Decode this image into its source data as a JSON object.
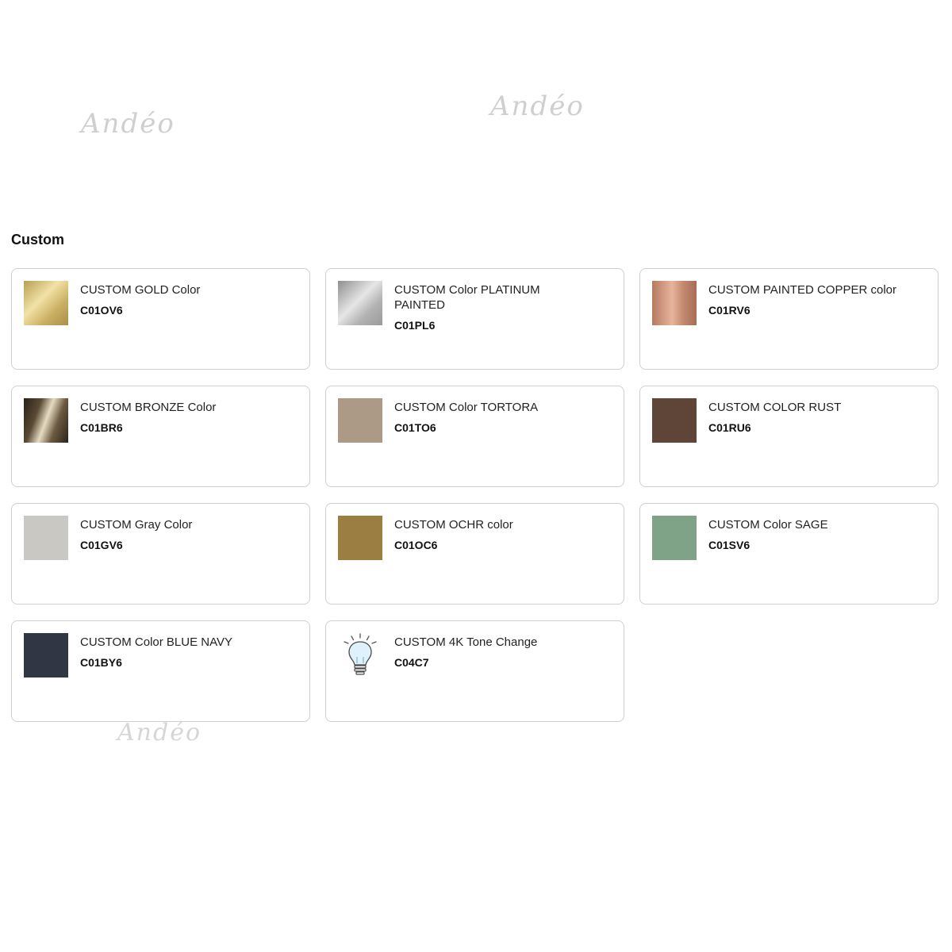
{
  "watermark": "Andéo",
  "section": {
    "title": "Custom"
  },
  "items": [
    {
      "name": "CUSTOM GOLD Color",
      "code": "C01OV6",
      "swatch": "linear-gradient(135deg,#b79f55 0%,#f1e2a6 40%,#c9ae62 70%,#a98f49 100%)"
    },
    {
      "name": "CUSTOM Color PLATINUM PAINTED",
      "code": "C01PL6",
      "swatch": "linear-gradient(135deg,#8f8f8f 0%,#e6e6e6 45%,#b2b2b2 70%,#9a9a9a 100%)"
    },
    {
      "name": "CUSTOM PAINTED COPPER color",
      "code": "C01RV6",
      "swatch": "linear-gradient(90deg,#b57a62 0%,#e7b49c 45%,#c38a70 70%,#a86d55 100%)"
    },
    {
      "name": "CUSTOM BRONZE Color",
      "code": "C01BR6",
      "swatch": "linear-gradient(110deg,#2a2118 0%,#5a4a35 30%,#e6dcc2 50%,#6d5b42 70%,#2b2219 100%)"
    },
    {
      "name": "CUSTOM Color TORTORA",
      "code": "C01TO6",
      "swatch": "#ad9a86"
    },
    {
      "name": "CUSTOM COLOR RUST",
      "code": "C01RU6",
      "swatch": "#5e4537"
    },
    {
      "name": "CUSTOM Gray Color",
      "code": "C01GV6",
      "swatch": "#c9c8c3"
    },
    {
      "name": "CUSTOM OCHR color",
      "code": "C01OC6",
      "swatch": "#9a7e42"
    },
    {
      "name": "CUSTOM Color SAGE",
      "code": "C01SV6",
      "swatch": "#7ea386"
    },
    {
      "name": "CUSTOM Color BLUE NAVY",
      "code": "C01BY6",
      "swatch": "#313644"
    },
    {
      "name": "CUSTOM 4K Tone Change",
      "code": "C04C7",
      "icon": "light-bulb-icon"
    }
  ]
}
